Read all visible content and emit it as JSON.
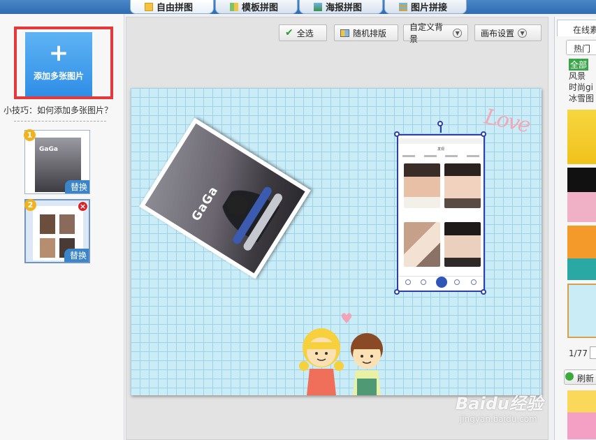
{
  "tabs": [
    {
      "label": "自由拼图",
      "icon": "free-collage-icon",
      "active": true
    },
    {
      "label": "模板拼图",
      "icon": "template-icon",
      "active": false
    },
    {
      "label": "海报拼图",
      "icon": "poster-icon",
      "active": false
    },
    {
      "label": "图片拼接",
      "icon": "stitch-icon",
      "active": false
    }
  ],
  "left_panel": {
    "add_button": "添加多张图片",
    "tip": "小技巧：如何添加多张图片？",
    "thumbnails": [
      {
        "number": "1",
        "replace_label": "替换"
      },
      {
        "number": "2",
        "replace_label": "替换"
      }
    ]
  },
  "toolbar": {
    "select_all": "全选",
    "random_layout": "随机排版",
    "custom_background": "自定义背景",
    "canvas_settings": "画布设置"
  },
  "canvas": {
    "phone1_brand": "GaGa",
    "phone2_title": "发现",
    "love_text": "Love"
  },
  "right_panel": {
    "tab": "在线素",
    "filter": "热门",
    "categories": [
      "全部",
      "风景",
      "时尚gi",
      "冰雪图"
    ],
    "pager": "1/77",
    "refresh": "刷新"
  },
  "watermark": {
    "main": "Baidu经验",
    "sub": "jingyan.baidu.com"
  },
  "colors": {
    "accent": "#2f6db0",
    "canvas_bg": "#c9ecf7",
    "grid": "#9fd2e8",
    "highlight_frame": "#e5383b",
    "selection": "#2d3eab"
  }
}
